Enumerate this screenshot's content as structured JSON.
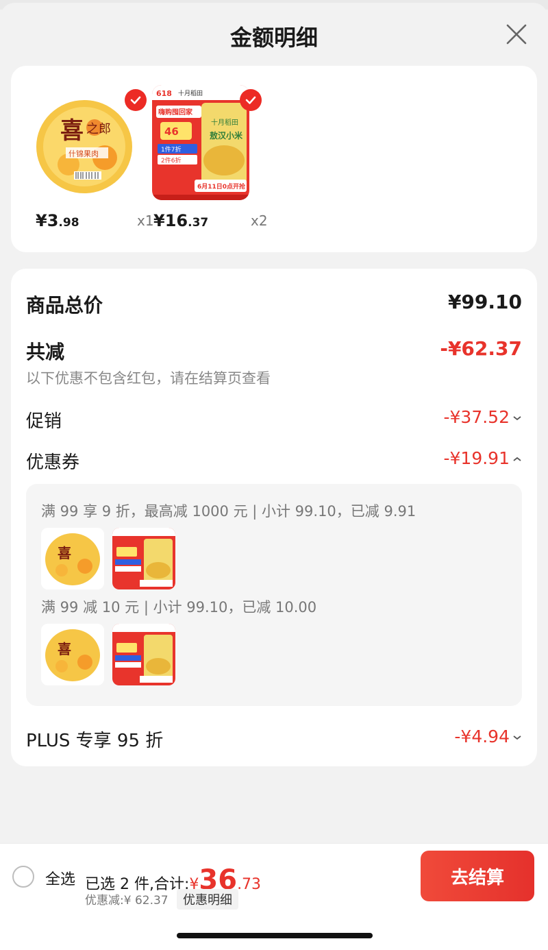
{
  "header": {
    "title": "金额明细"
  },
  "products": [
    {
      "price_int": "¥3",
      "price_dec": ".98",
      "qty": "x1",
      "label": "什锦果肉"
    },
    {
      "price_int": "¥16",
      "price_dec": ".37",
      "qty": "x2",
      "label": "十月稻田"
    }
  ],
  "details": {
    "total_label": "商品总价",
    "total_value": "¥99.10",
    "reduce_label": "共减",
    "reduce_value": "-¥62.37",
    "reduce_note": "以下优惠不包含红包，请在结算页查看",
    "promo_label": "促销",
    "promo_value": "-¥37.52",
    "coupon_label": "优惠券",
    "coupon_value": "-¥19.91",
    "coupons": [
      {
        "text": "满 99 享 9 折，最高减 1000 元 | 小计 99.10，已减 9.91"
      },
      {
        "text": "满 99 减 10 元 | 小计 99.10，已减 10.00"
      }
    ],
    "plus_label": "PLUS 专享 95 折",
    "plus_value": "-¥4.94"
  },
  "bottom": {
    "select_all": "全选",
    "summary_prefix": "已选 2 件,合计:",
    "currency": "¥",
    "amount_int": "36",
    "amount_dec": ".73",
    "saved": "优惠减:¥ 62.37",
    "detail_link": "优惠明细",
    "checkout": "去结算"
  },
  "colors": {
    "accent": "#e8332b",
    "check": "#ec2b25"
  }
}
